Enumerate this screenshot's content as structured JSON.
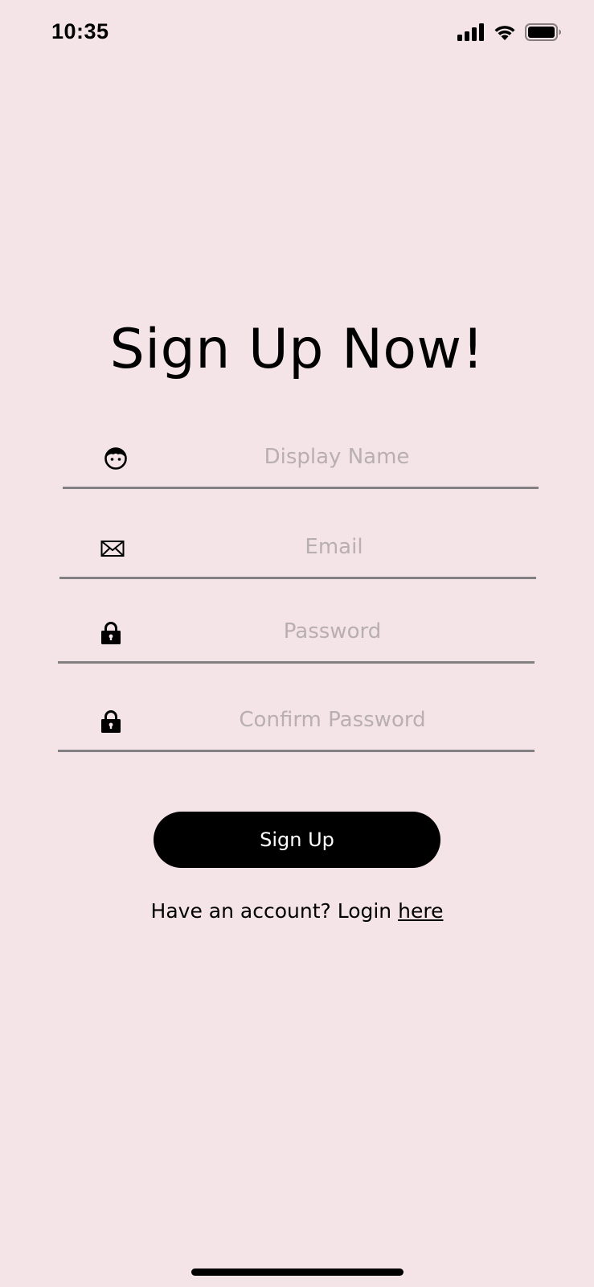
{
  "status_bar": {
    "time": "10:35",
    "icons": [
      "cellular-signal-icon",
      "wifi-icon",
      "battery-icon"
    ]
  },
  "title": "Sign Up Now!",
  "form": {
    "display_name": {
      "placeholder": "Display Name",
      "value": "",
      "icon": "face-icon"
    },
    "email": {
      "placeholder": "Email",
      "value": "",
      "icon": "envelope-icon"
    },
    "password": {
      "placeholder": "Password",
      "value": "",
      "icon": "lock-icon"
    },
    "confirm_password": {
      "placeholder": "Confirm Password",
      "value": "",
      "icon": "lock-icon"
    }
  },
  "signup_button_label": "Sign Up",
  "login_prompt": {
    "text": "Have an account? Login ",
    "link_text": "here"
  },
  "colors": {
    "background": "#f4e4e7",
    "button": "#000000",
    "button_text": "#ffffff",
    "placeholder": "#b8afb2",
    "underline": "#838083"
  }
}
